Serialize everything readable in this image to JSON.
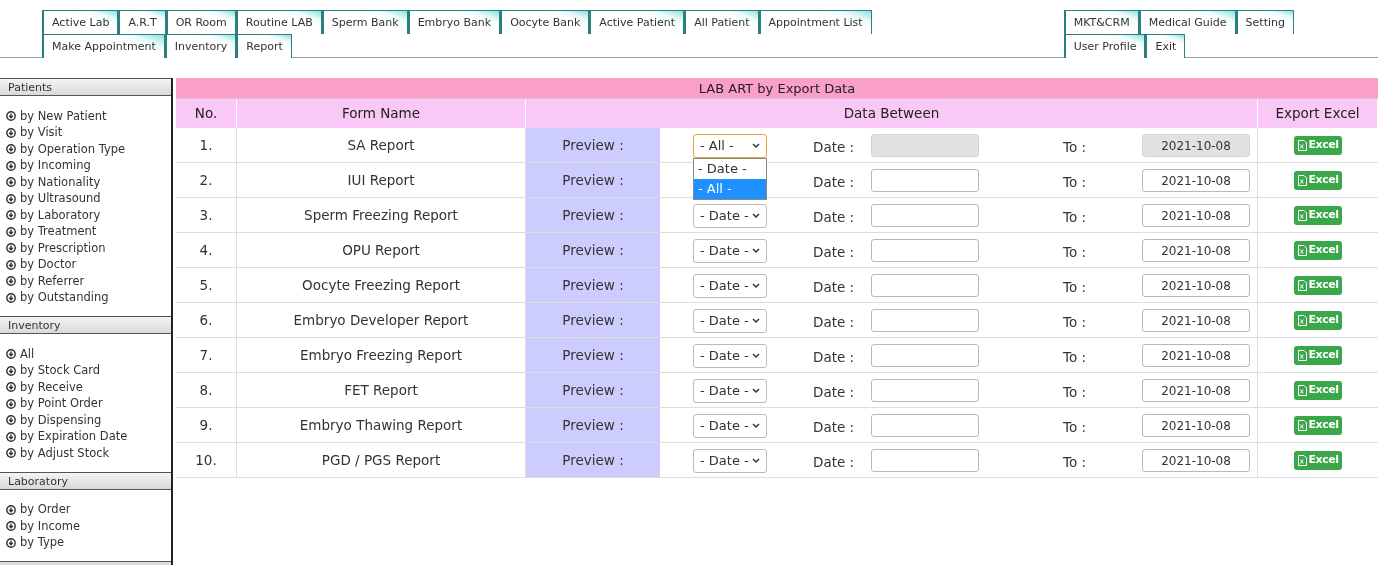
{
  "tabs_left": [
    [
      "Active Lab",
      "A.R.T",
      "OR Room",
      "Routine LAB",
      "Sperm Bank",
      "Embryo Bank",
      "Oocyte Bank",
      "Active Patient",
      "All Patient",
      "Appointment List"
    ],
    [
      "Make Appointment",
      "Inventory",
      "Report"
    ]
  ],
  "tabs_right": [
    [
      "MKT&CRM",
      "Medical Guide",
      "Setting"
    ],
    [
      "User Profile",
      "Exit"
    ]
  ],
  "sidebar": [
    {
      "title": "Patients",
      "items": [
        "by New Patient",
        "by Visit",
        "by Operation Type",
        "by Incoming",
        "by Nationality",
        "by Ultrasound",
        "by Laboratory",
        "by Treatment",
        "by Prescription",
        "by Doctor",
        "by Referrer",
        "by Outstanding"
      ]
    },
    {
      "title": "Inventory",
      "items": [
        "All",
        "by Stock Card",
        "by Receive",
        "by Point Order",
        "by Dispensing",
        "by Expiration Date",
        "by Adjust Stock"
      ]
    },
    {
      "title": "Laboratory",
      "items": [
        "by Order",
        "by Income",
        "by Type"
      ]
    }
  ],
  "table": {
    "title": "LAB ART by Export Data",
    "columns": [
      "No.",
      "Form Name",
      "Data Between",
      "Export Excel"
    ],
    "rows": [
      {
        "no": "1.",
        "name": "SA Report",
        "preview": "Preview :",
        "filter": "- All -",
        "date_label": "Date :",
        "to_label": "To :",
        "to": "2021-10-08",
        "disabled": true,
        "excel": "Excel",
        "dropdown": [
          {
            "label": "- Date -",
            "selected": false
          },
          {
            "label": "- All -",
            "selected": true
          }
        ]
      },
      {
        "no": "2.",
        "name": "IUI Report",
        "preview": "Preview :",
        "date_label": "Date :",
        "to_label": "To :",
        "to": "2021-10-08",
        "disabled": false,
        "excel": "Excel"
      },
      {
        "no": "3.",
        "name": "Sperm Freezing Report",
        "preview": "Preview :",
        "filter": "- Date -",
        "date_label": "Date :",
        "to_label": "To :",
        "to": "2021-10-08",
        "disabled": false,
        "excel": "Excel"
      },
      {
        "no": "4.",
        "name": "OPU Report",
        "preview": "Preview :",
        "filter": "- Date -",
        "date_label": "Date :",
        "to_label": "To :",
        "to": "2021-10-08",
        "disabled": false,
        "excel": "Excel"
      },
      {
        "no": "5.",
        "name": "Oocyte Freezing Report",
        "preview": "Preview :",
        "filter": "- Date -",
        "date_label": "Date :",
        "to_label": "To :",
        "to": "2021-10-08",
        "disabled": false,
        "excel": "Excel"
      },
      {
        "no": "6.",
        "name": "Embryo Developer Report",
        "preview": "Preview :",
        "filter": "- Date -",
        "date_label": "Date :",
        "to_label": "To :",
        "to": "2021-10-08",
        "disabled": false,
        "excel": "Excel"
      },
      {
        "no": "7.",
        "name": "Embryo Freezing Report",
        "preview": "Preview :",
        "filter": "- Date -",
        "date_label": "Date :",
        "to_label": "To :",
        "to": "2021-10-08",
        "disabled": false,
        "excel": "Excel"
      },
      {
        "no": "8.",
        "name": "FET Report",
        "preview": "Preview :",
        "filter": "- Date -",
        "date_label": "Date :",
        "to_label": "To :",
        "to": "2021-10-08",
        "disabled": false,
        "excel": "Excel"
      },
      {
        "no": "9.",
        "name": "Embryo Thawing Report",
        "preview": "Preview :",
        "filter": "- Date -",
        "date_label": "Date :",
        "to_label": "To :",
        "to": "2021-10-08",
        "disabled": false,
        "excel": "Excel"
      },
      {
        "no": "10.",
        "name": "PGD / PGS Report",
        "preview": "Preview :",
        "filter": "- Date -",
        "date_label": "Date :",
        "to_label": "To :",
        "to": "2021-10-08",
        "disabled": false,
        "excel": "Excel"
      }
    ]
  }
}
